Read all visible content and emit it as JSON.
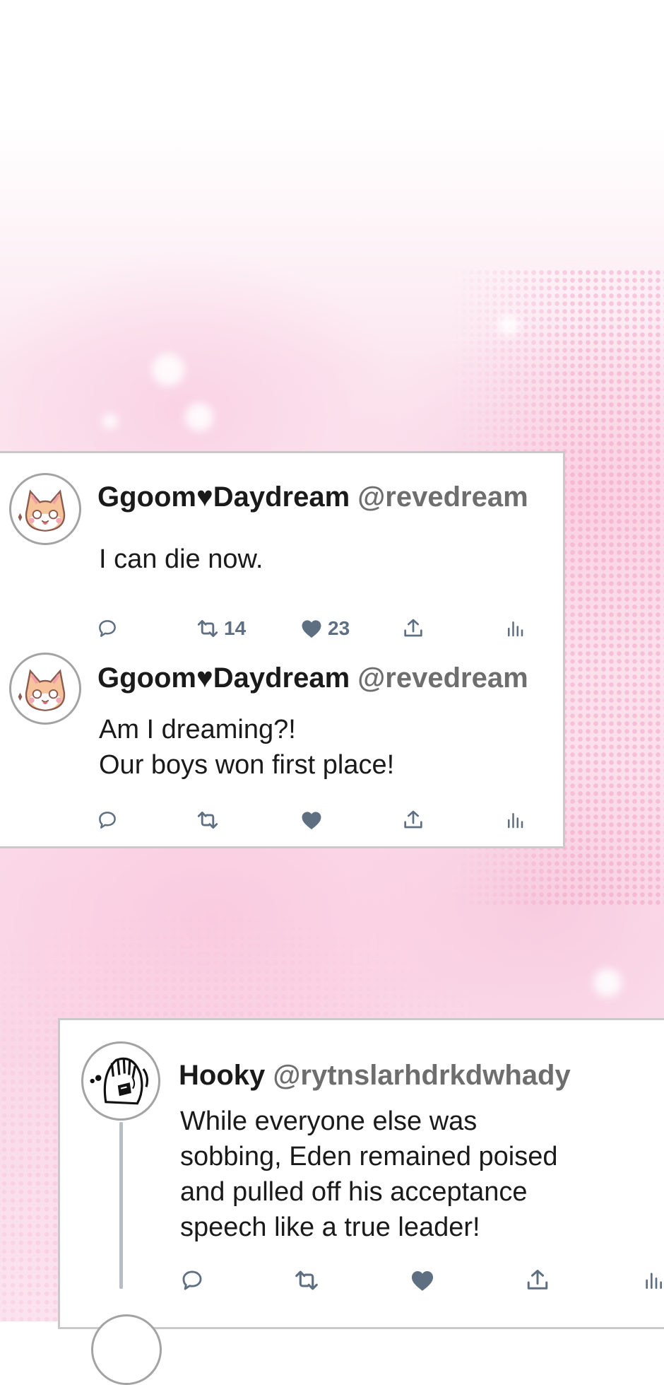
{
  "colors": {
    "card_border": "#c9c9c9",
    "icon": "#5f6f82",
    "handle": "#6e6e6e"
  },
  "tweets": [
    {
      "display_name": "Ggoom♥Daydream",
      "handle": "@revedream",
      "avatar": "cat-avatar",
      "lines": [
        "I can die now."
      ],
      "retweets": "14",
      "likes": "23"
    },
    {
      "display_name": "Ggoom♥Daydream",
      "handle": "@revedream",
      "avatar": "cat-avatar",
      "lines": [
        "Am I dreaming?!",
        "Our boys won first place!"
      ]
    },
    {
      "display_name": "Hooky",
      "handle": "@rytnslarhdrkdwhady",
      "avatar": "crying-doodle-avatar",
      "lines": [
        "While everyone else was",
        "sobbing, Eden remained poised",
        "and pulled off his acceptance",
        "speech like a true leader!"
      ]
    }
  ],
  "icons": [
    "reply-icon",
    "retweet-icon",
    "like-icon",
    "share-icon",
    "analytics-icon"
  ]
}
